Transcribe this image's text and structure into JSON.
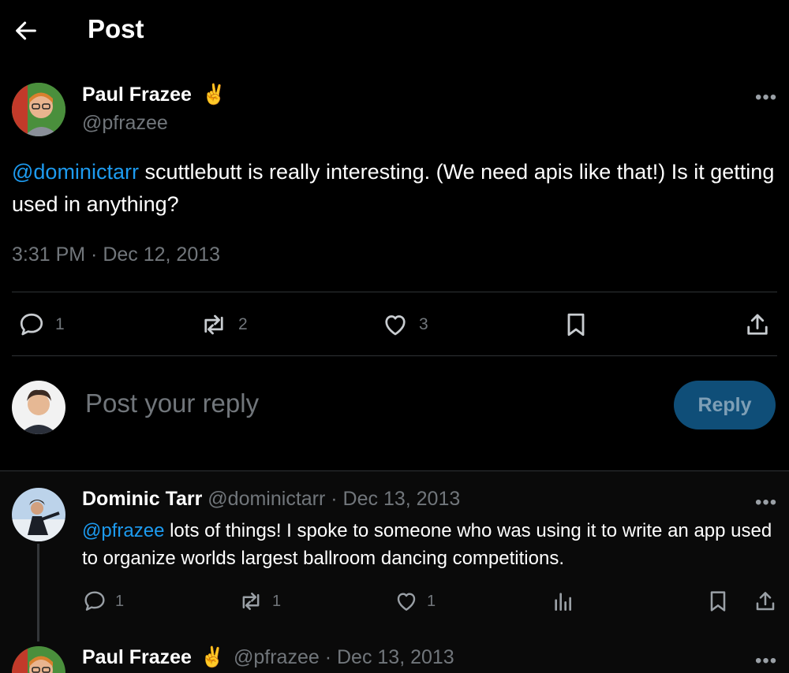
{
  "header": {
    "title": "Post"
  },
  "main_post": {
    "author_name": "Paul Frazee",
    "author_emoji": "✌️",
    "handle": "@pfrazee",
    "mention": "@dominictarr",
    "text": " scuttlebutt is really interesting. (We need apis like that!) Is it getting used in anything?",
    "timestamp": "3:31 PM · Dec 12, 2013",
    "actions": {
      "replies": "1",
      "reposts": "2",
      "likes": "3"
    }
  },
  "composer": {
    "placeholder": "Post your reply",
    "button_label": "Reply"
  },
  "replies": [
    {
      "author_name": "Dominic Tarr",
      "handle": "@dominictarr",
      "date": "· Dec 13, 2013",
      "mention": "@pfrazee",
      "text": " lots of things! I spoke to someone who was using it to write an app used to organize worlds largest ballroom dancing competitions.",
      "actions": {
        "replies": "1",
        "reposts": "1",
        "likes": "1"
      }
    },
    {
      "author_name": "Paul Frazee",
      "author_emoji": "✌️",
      "handle": "@pfrazee",
      "date": "· Dec 13, 2013"
    }
  ],
  "more_label": "•••",
  "colors": {
    "accent": "#1d9bf0",
    "reply_button": "#0f4e78",
    "muted": "#71767b"
  }
}
